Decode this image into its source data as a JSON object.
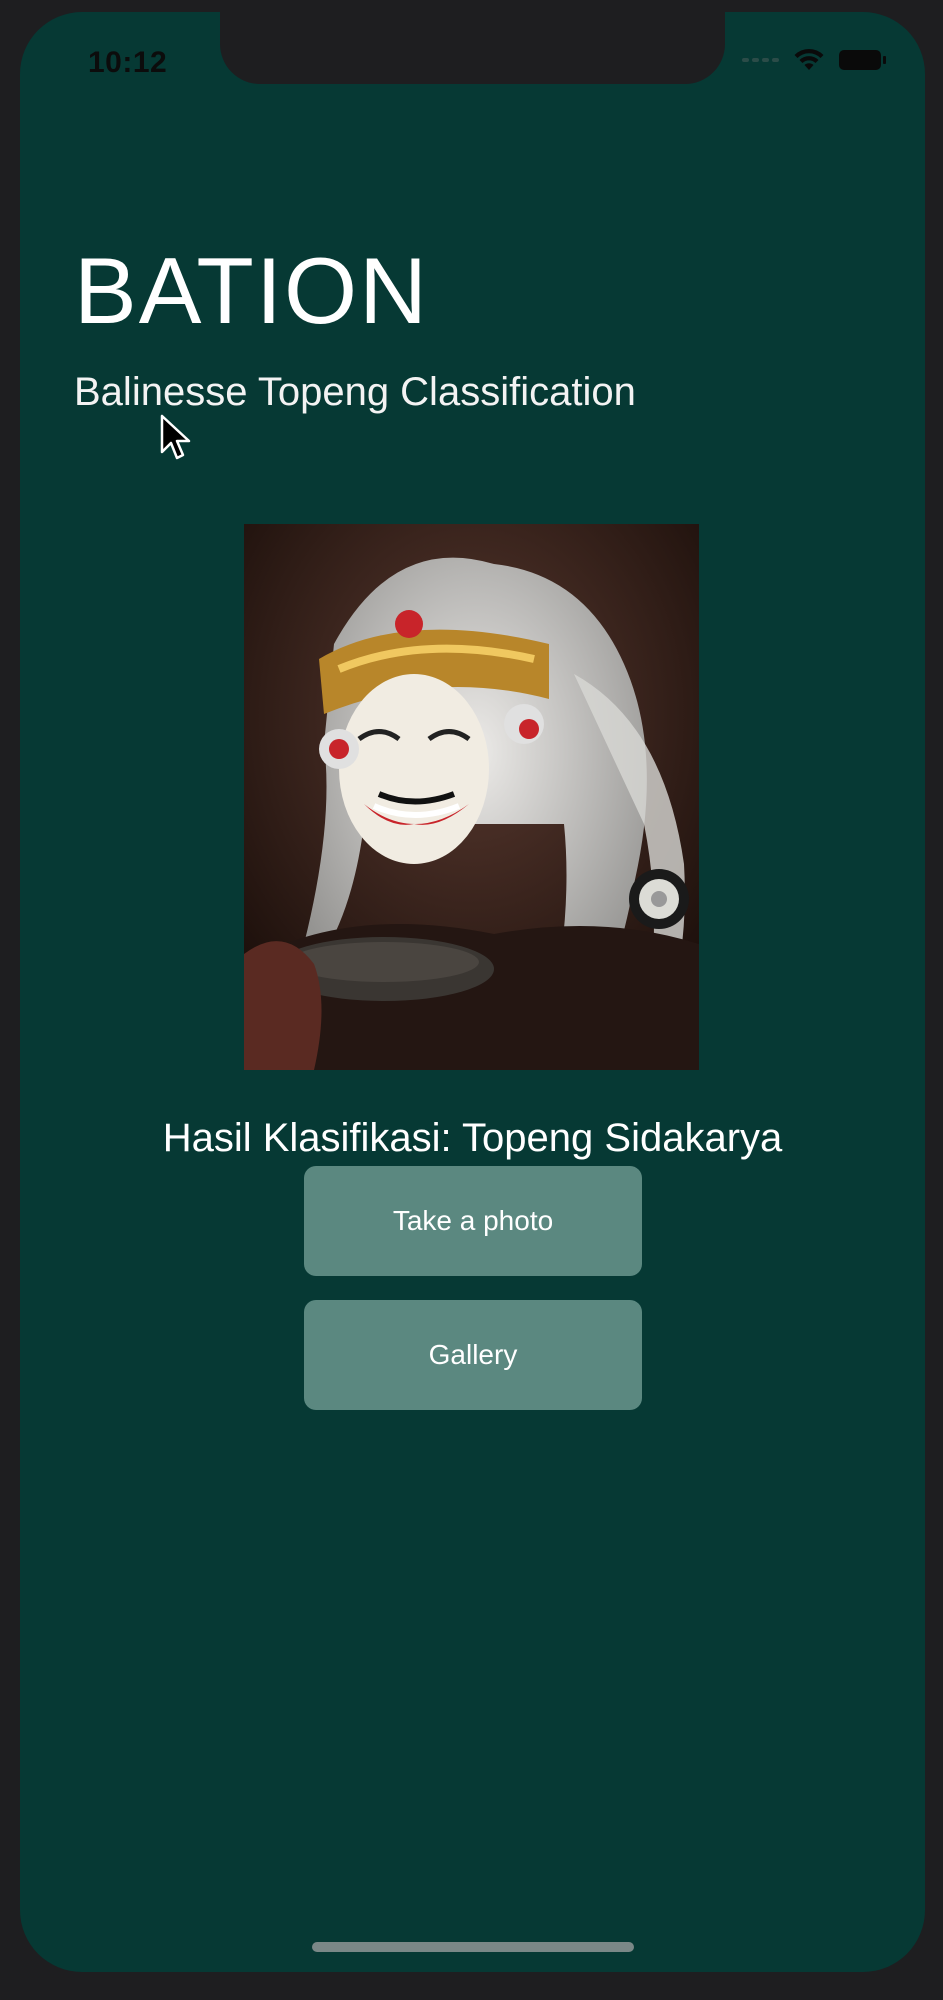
{
  "status_bar": {
    "time": "10:12"
  },
  "app": {
    "title": "BATION",
    "subtitle": "Balinesse Topeng Classification"
  },
  "result": {
    "text": "Hasil Klasifikasi: Topeng Sidakarya"
  },
  "buttons": {
    "take_photo_label": "Take a photo",
    "gallery_label": "Gallery"
  },
  "colors": {
    "background": "#063934",
    "button": "#5b8880",
    "text": "#ffffff"
  },
  "icons": [
    "wifi-icon",
    "battery-icon",
    "signal-icon",
    "mouse-cursor-icon"
  ]
}
